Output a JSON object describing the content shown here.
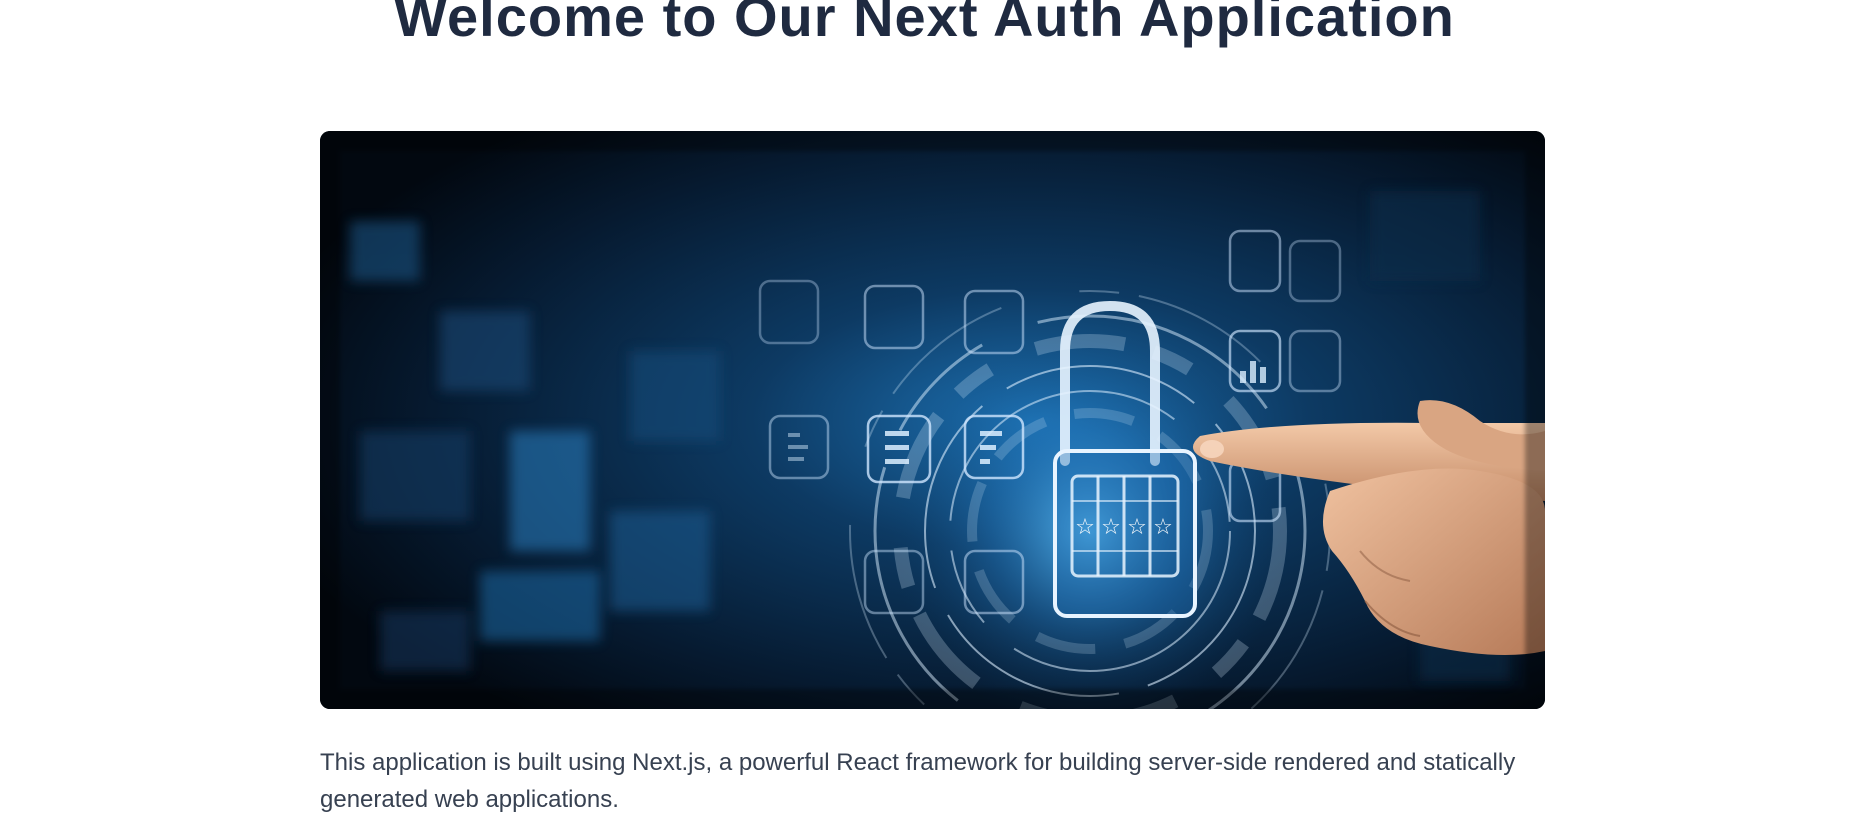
{
  "header": {
    "title": "Welcome to Our Next Auth Application"
  },
  "hero_image": {
    "subject": "padlock-cybersecurity-hologram-with-pointing-hand",
    "lock_code_symbols": [
      "☆",
      "☆",
      "☆",
      "☆"
    ],
    "colors": {
      "background_dark": "#03101d",
      "glow": "#2f8fd6",
      "hologram_line": "#dcefff",
      "skin": "#e8b594"
    }
  },
  "main": {
    "description": "This application is built using Next.js, a powerful React framework for building server-side rendered and statically generated web applications."
  },
  "colors": {
    "heading": "#1f2a40",
    "body_text": "#374151",
    "page_background": "#ffffff"
  }
}
